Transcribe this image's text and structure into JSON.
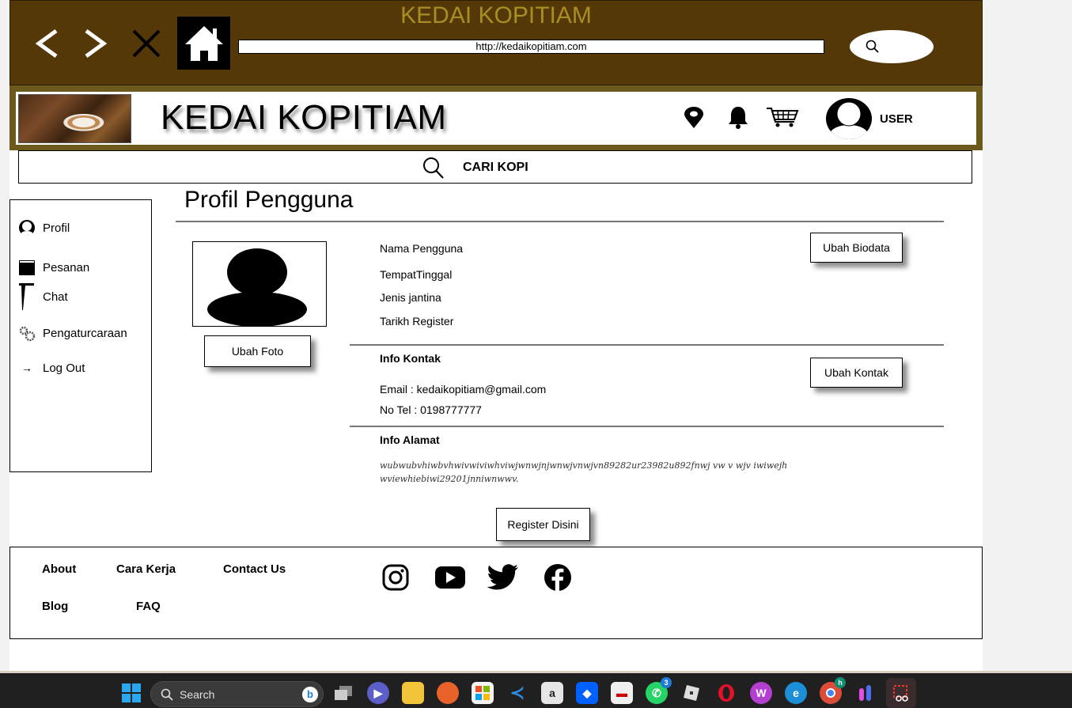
{
  "browser": {
    "title": "KEDAI KOPITIAM",
    "url": "http://kedaikopitiam.com",
    "icons": [
      "back-icon",
      "forward-icon",
      "close-icon",
      "home-icon",
      "search-icon"
    ]
  },
  "header": {
    "site_title": "KEDAI KOPITIAM",
    "user_label": "USER",
    "icons": [
      "location-pin-icon",
      "bell-icon",
      "cart-icon",
      "user-avatar-icon"
    ]
  },
  "search": {
    "label": "CARI KOPI"
  },
  "sidebar": {
    "items": [
      {
        "label": "Profil",
        "icon": "profile-icon"
      },
      {
        "label": "Pesanan",
        "icon": "orders-icon"
      },
      {
        "label": "Chat",
        "icon": "chat-icon"
      },
      {
        "label": "Pengaturcaraan",
        "icon": "gears-icon"
      },
      {
        "label": "Log Out",
        "icon": "arrow-right-icon",
        "glyph": "→"
      }
    ]
  },
  "main": {
    "page_title": "Profil Pengguna",
    "ubah_foto": "Ubah Foto",
    "ubah_biodata": "Ubah Biodata",
    "ubah_kontak": "Ubah Kontak",
    "register": "Register Disini",
    "bio_fields": [
      "Nama Pengguna",
      "TempatTinggal",
      "Jenis jantina",
      "Tarikh Register"
    ],
    "contact_heading": "Info Kontak",
    "email": "Email : kedaikopitiam@gmail.com",
    "phone": "No Tel : 0198777777",
    "address_heading": "Info Alamat",
    "address_text": "wubwubvhiwbvhwivwiviwhviwjwnwjnjwnwjvnwjvn89282ur23982u892fnwj vw v wjv iwiwejhwviewhiebiwi29201jnniwnwwv."
  },
  "footer": {
    "links": [
      "About",
      "Cara Kerja",
      "Contact Us",
      "Blog",
      "FAQ"
    ],
    "social": [
      "instagram-icon",
      "youtube-icon",
      "twitter-icon",
      "facebook-icon"
    ]
  },
  "taskbar": {
    "search_label": "Search",
    "whatsapp_badge": "3",
    "colors": {
      "background": "#202020",
      "accent": "#1d7bd8"
    }
  },
  "colors": {
    "browser_bar": "#543807",
    "browser_title": "#a88d22",
    "header_border": "#6b5a1c"
  }
}
